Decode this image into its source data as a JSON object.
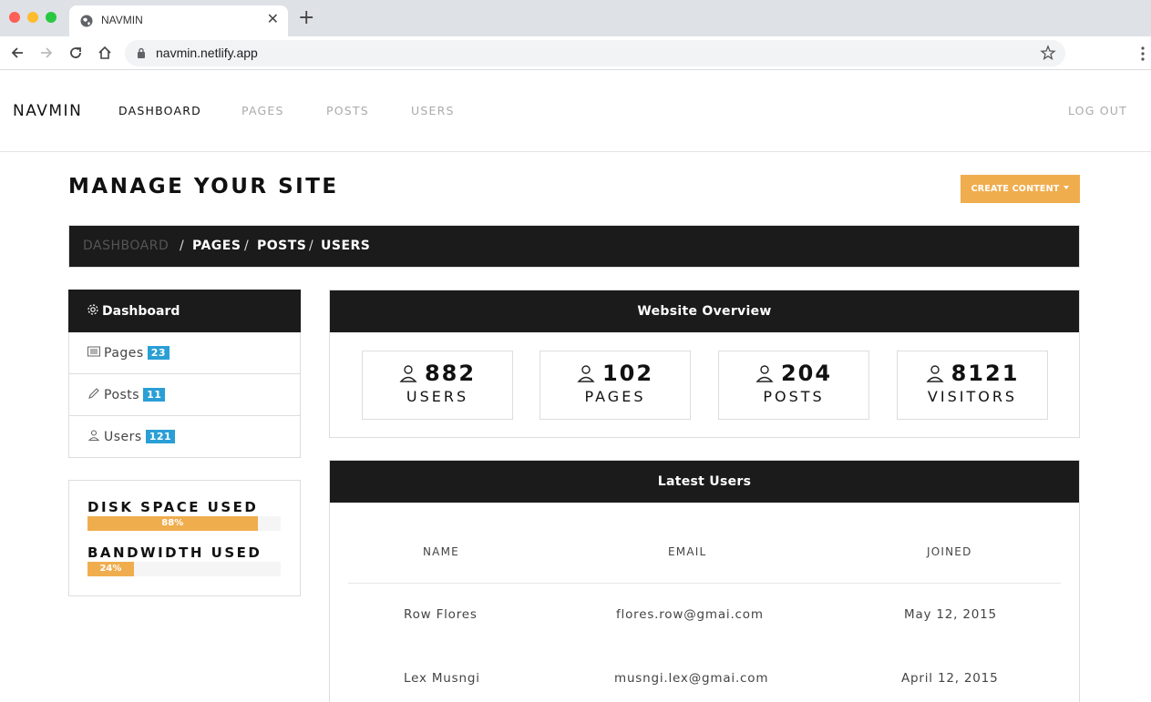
{
  "browser": {
    "tab_title": "NAVMIN",
    "url": "navmin.netlify.app"
  },
  "navbar": {
    "brand": "NAVMIN",
    "links": [
      "DASHBOARD",
      "PAGES",
      "POSTS",
      "USERS"
    ],
    "logout": "LOG OUT"
  },
  "header": {
    "title": "MANAGE YOUR SITE",
    "create_button": "CREATE CONTENT"
  },
  "breadcrumb": [
    "DASHBOARD",
    "PAGES",
    "POSTS",
    "USERS"
  ],
  "sidebar": {
    "heading": "Dashboard",
    "items": [
      {
        "label": "Pages",
        "count": "23",
        "icon": "list-icon"
      },
      {
        "label": "Posts",
        "count": "11",
        "icon": "pencil-icon"
      },
      {
        "label": "Users",
        "count": "121",
        "icon": "user-icon"
      }
    ]
  },
  "usage": {
    "disk_label": "DISK SPACE USED",
    "disk_text": "88%",
    "disk_value": 0.88,
    "bandwidth_label": "BANDWIDTH USED",
    "bandwidth_text": "24%",
    "bandwidth_value": 0.24
  },
  "overview": {
    "title": "Website Overview",
    "stats": [
      {
        "value": "882",
        "label": "USERS"
      },
      {
        "value": "102",
        "label": "PAGES"
      },
      {
        "value": "204",
        "label": "POSTS"
      },
      {
        "value": "8121",
        "label": "VISITORS"
      }
    ]
  },
  "latest_users": {
    "title": "Latest Users",
    "columns": [
      "NAME",
      "EMAIL",
      "JOINED"
    ],
    "rows": [
      {
        "name": "Row Flores",
        "email": "flores.row@gmai.com",
        "joined": "May 12, 2015"
      },
      {
        "name": "Lex Musngi",
        "email": "musngi.lex@gmai.com",
        "joined": "April 12, 2015"
      }
    ]
  },
  "colors": {
    "accent": "#f0ad4e",
    "dark": "#1b1b1b",
    "badge": "#2a9fd6"
  }
}
